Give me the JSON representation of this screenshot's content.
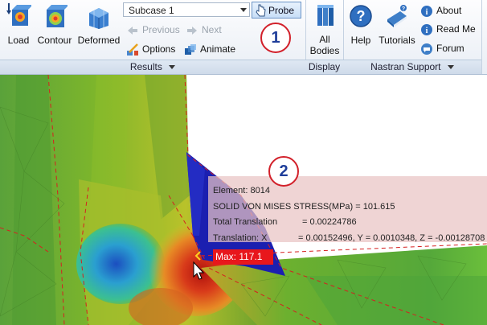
{
  "ribbon": {
    "results": {
      "label": "Results",
      "load": "Load",
      "contour": "Contour",
      "deformed": "Deformed",
      "subcase": "Subcase 1",
      "probe": "Probe",
      "previous": "Previous",
      "next": "Next",
      "options": "Options",
      "animate": "Animate"
    },
    "display": {
      "label": "Display",
      "all_bodies_line1": "All",
      "all_bodies_line2": "Bodies"
    },
    "nastran": {
      "label": "Nastran Support",
      "help": "Help",
      "tutorials": "Tutorials",
      "about": "About",
      "read_me": "Read Me",
      "forum": "Forum"
    }
  },
  "callouts": {
    "one": "1",
    "two": "2"
  },
  "probe_tooltip": {
    "element": "Element: 8014",
    "stress": "SOLID VON MISES STRESS(MPa) = 101.615",
    "total_translation_label": "Total Translation",
    "total_translation_value": "= 0.00224786",
    "translation_label": "Translation:  X",
    "translation_value": "= 0.00152496, Y = 0.0010348, Z = -0.00128708"
  },
  "max_marker": "Max: 117.1",
  "colors": {
    "callout_ring": "#d2202a",
    "callout_text": "#1f3e9a",
    "marker": "#e8171c",
    "accent": "#3f7fc8"
  }
}
